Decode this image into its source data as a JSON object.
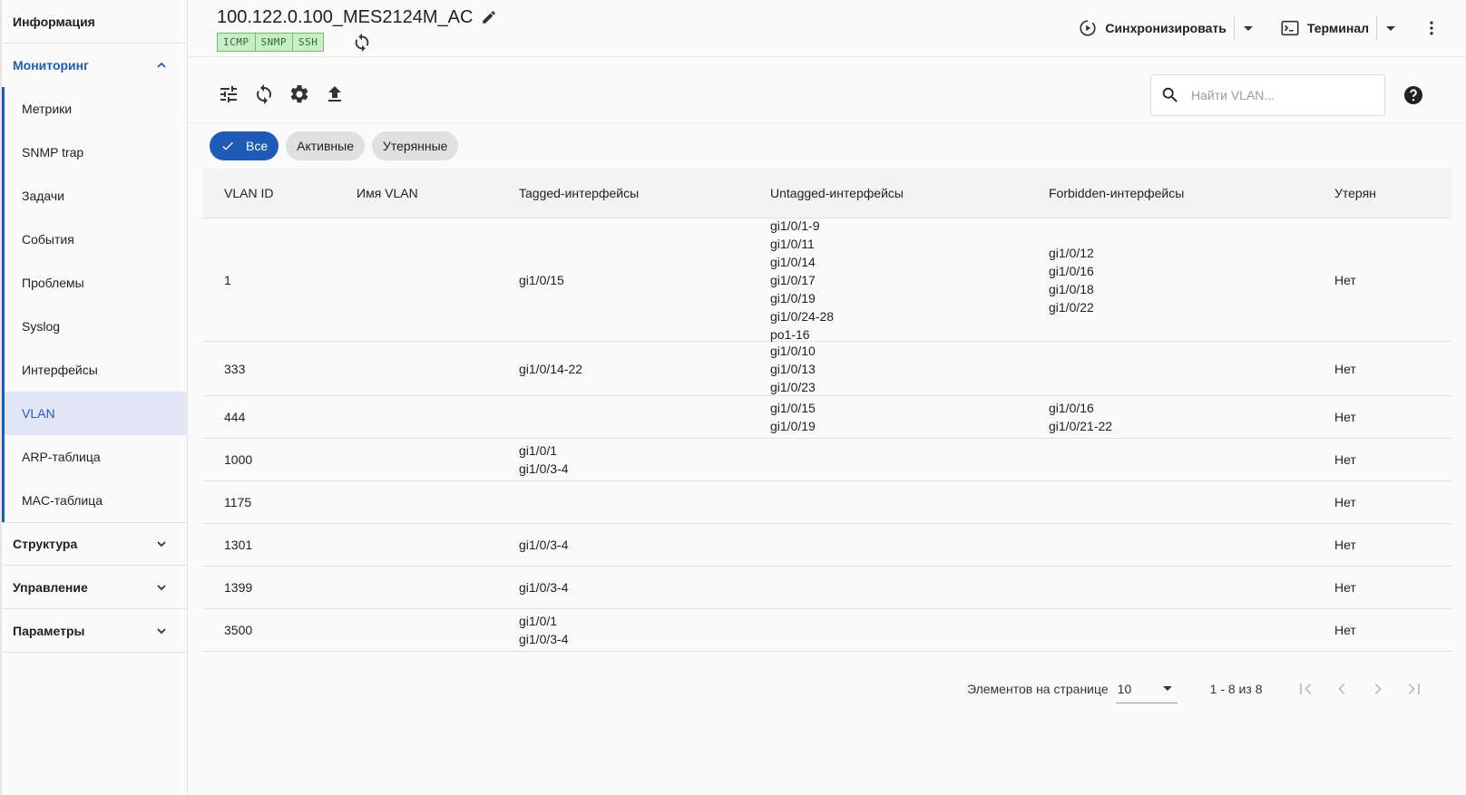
{
  "sidebar": {
    "info_label": "Информация",
    "monitoring": {
      "label": "Мониторинг",
      "items": [
        {
          "label": "Метрики"
        },
        {
          "label": "SNMP trap"
        },
        {
          "label": "Задачи"
        },
        {
          "label": "События"
        },
        {
          "label": "Проблемы"
        },
        {
          "label": "Syslog"
        },
        {
          "label": "Интерфейсы"
        },
        {
          "label": "VLAN",
          "active": true
        },
        {
          "label": "ARP-таблица"
        },
        {
          "label": "MAC-таблица"
        }
      ]
    },
    "structure_label": "Структура",
    "management_label": "Управление",
    "parameters_label": "Параметры"
  },
  "header": {
    "title": "100.122.0.100_MES2124M_AC",
    "badges": [
      "ICMP",
      "SNMP",
      "SSH"
    ],
    "sync_label": "Синхронизировать",
    "terminal_label": "Терминал"
  },
  "toolbar": {
    "search_placeholder": "Найти VLAN..."
  },
  "filters": {
    "all": "Все",
    "active": "Активные",
    "lost": "Утерянные"
  },
  "table": {
    "columns": [
      "VLAN ID",
      "Имя VLAN",
      "Tagged-интерфейсы",
      "Untagged-интерфейсы",
      "Forbidden-интерфейсы",
      "Утерян"
    ],
    "rows": [
      {
        "id": "1",
        "name": "",
        "tagged": [
          "gi1/0/15"
        ],
        "untagged": [
          "gi1/0/1-9",
          "gi1/0/11",
          "gi1/0/14",
          "gi1/0/17",
          "gi1/0/19",
          "gi1/0/24-28",
          "po1-16"
        ],
        "forbidden": [
          "gi1/0/12",
          "gi1/0/16",
          "gi1/0/18",
          "gi1/0/22"
        ],
        "lost": "Нет"
      },
      {
        "id": "333",
        "name": "",
        "tagged": [
          "gi1/0/14-22"
        ],
        "untagged": [
          "gi1/0/10",
          "gi1/0/13",
          "gi1/0/23"
        ],
        "forbidden": [],
        "lost": "Нет"
      },
      {
        "id": "444",
        "name": "",
        "tagged": [],
        "untagged": [
          "gi1/0/15",
          "gi1/0/19"
        ],
        "forbidden": [
          "gi1/0/16",
          "gi1/0/21-22"
        ],
        "lost": "Нет"
      },
      {
        "id": "1000",
        "name": "",
        "tagged": [
          "gi1/0/1",
          "gi1/0/3-4"
        ],
        "untagged": [],
        "forbidden": [],
        "lost": "Нет"
      },
      {
        "id": "1175",
        "name": "",
        "tagged": [],
        "untagged": [],
        "forbidden": [],
        "lost": "Нет"
      },
      {
        "id": "1301",
        "name": "",
        "tagged": [
          "gi1/0/3-4"
        ],
        "untagged": [],
        "forbidden": [],
        "lost": "Нет"
      },
      {
        "id": "1399",
        "name": "",
        "tagged": [
          "gi1/0/3-4"
        ],
        "untagged": [],
        "forbidden": [],
        "lost": "Нет"
      },
      {
        "id": "3500",
        "name": "",
        "tagged": [
          "gi1/0/1",
          "gi1/0/3-4"
        ],
        "untagged": [],
        "forbidden": [],
        "lost": "Нет"
      }
    ]
  },
  "pagination": {
    "per_page_label": "Элементов на странице",
    "per_page_value": "10",
    "range": "1 - 8 из 8"
  }
}
